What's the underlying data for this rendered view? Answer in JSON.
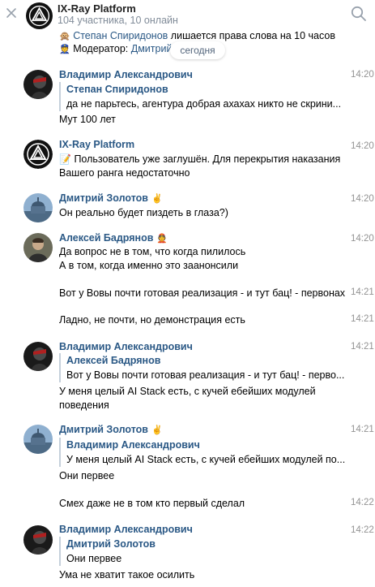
{
  "header": {
    "title": "IX-Ray Platform",
    "subtitle": "104 участника, 10 онлайн"
  },
  "system": {
    "line1_name": "Степан Спиридонов",
    "line1_text": "лишается права слова на 10 часов",
    "line2_label": "Модератор:",
    "line2_name": "Дмитрий"
  },
  "date_divider": "сегодня",
  "messages": [
    {
      "author": "Владимир Александрович",
      "time": "14:20",
      "quote_author": "Степан Спиридонов",
      "quote_text": "да не парьтесь, агентура добрая ахахах никто не скрини...",
      "text": "Мут 100 лет"
    },
    {
      "author": "IX-Ray Platform",
      "time": "14:20",
      "text": "Пользователь уже заглушён. Для перекрытия наказания",
      "text2": "Вашего ранга недостаточно"
    },
    {
      "author": "Дмитрий Золотов",
      "time": "14:20",
      "text": "Он реально будет пиздеть в глаза?)"
    },
    {
      "author": "Алексей Бадрянов",
      "time": "14:20",
      "text": "Да вопрос не в том, что когда пилилось",
      "text2": "А в том, когда именно это заанонсили"
    },
    {
      "time": "14:21",
      "text": "Вот у Вовы почти готовая реализация - и тут бац! -  первонах"
    },
    {
      "time": "14:21",
      "text": "Ладно, не почти, но демонстрация есть"
    },
    {
      "author": "Владимир Александрович",
      "time": "14:21",
      "quote_author": "Алексей Бадрянов",
      "quote_text": "Вот у Вовы почти готовая реализация - и тут бац! - перво...",
      "text": "У меня целый AI Stack есть, с кучей ебейших модулей",
      "text2": "поведения"
    },
    {
      "author": "Дмитрий Золотов",
      "time": "14:21",
      "quote_author": "Владимир Александрович",
      "quote_text": "У меня целый AI Stack есть, с кучей ебейших модулей по...",
      "text": "Они первее"
    },
    {
      "time": "14:22",
      "text": "Смех даже не в том кто первый сделал"
    },
    {
      "author": "Владимир Александрович",
      "time": "14:22",
      "quote_author": "Дмитрий Золотов",
      "quote_text": "Они первее",
      "text": "Ума не хватит такое осилить"
    }
  ]
}
